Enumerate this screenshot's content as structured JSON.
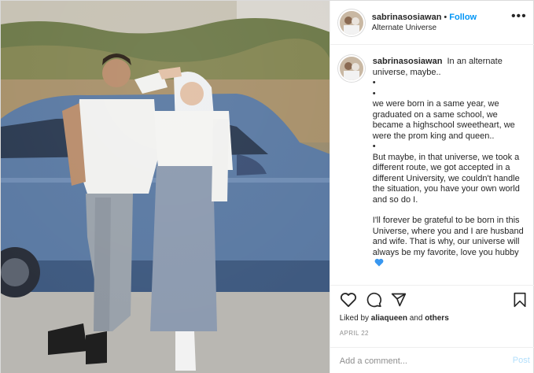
{
  "header": {
    "username": "sabrinasosiawan",
    "separator": "•",
    "follow_label": "Follow",
    "location": "Alternate Universe",
    "more_icon": "more-horizontal-icon"
  },
  "caption": {
    "username": "sabrinasosiawan",
    "lines": {
      "intro": "In an alternate universe, maybe..",
      "bullet1": "•",
      "bullet2": "•",
      "para1": "we were born in a same year, we graduated on a same school, we became a highschool sweetheart, we were the prom king and queen..",
      "bullet3": "•",
      "para2": "But maybe, in that universe, we took a different route, we got accepted in a different University, we couldn't handle the situation, you have your own world and so do I.",
      "para3": "I'll forever be grateful to be born in this Universe, where you and I are husband and wife. That is why, our universe will always be my favorite, love you hubby"
    },
    "heart_emoji": "blue-heart-icon",
    "heart_color": "#3897f0"
  },
  "actions": {
    "like_icon": "heart-icon",
    "comment_icon": "comment-icon",
    "share_icon": "share-icon",
    "save_icon": "bookmark-icon"
  },
  "likes": {
    "prefix": "Liked by",
    "user": "aliaqueen",
    "and": "and",
    "others": "others"
  },
  "date": "APRIL 22",
  "comment": {
    "placeholder": "Add a comment...",
    "post_label": "Post"
  },
  "colors": {
    "accent": "#0095f6",
    "post_disabled": "#b2dffc",
    "muted": "#8e8e8e",
    "car_blue": "#5b7aa3"
  }
}
